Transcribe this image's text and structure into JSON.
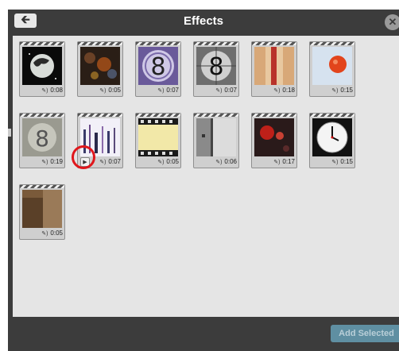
{
  "dialog": {
    "title": "Effects",
    "back_icon": "arrow-left-icon",
    "close_icon": "close-icon",
    "add_selected_label": "Add Selected"
  },
  "effects": [
    {
      "name": "earth-globe",
      "duration": "0:08"
    },
    {
      "name": "bokeh-lights",
      "duration": "0:05"
    },
    {
      "name": "countdown-8-purple",
      "duration": "0:07"
    },
    {
      "name": "countdown-8-gray",
      "duration": "0:07"
    },
    {
      "name": "film-burn-red",
      "duration": "0:18"
    },
    {
      "name": "orange-drop",
      "duration": "0:15"
    },
    {
      "name": "countdown-8-faded",
      "duration": "0:19"
    },
    {
      "name": "static-lines",
      "duration": "0:07"
    },
    {
      "name": "film-strip",
      "duration": "0:05"
    },
    {
      "name": "door-frame",
      "duration": "0:06"
    },
    {
      "name": "red-lights",
      "duration": "0:17"
    },
    {
      "name": "clock-face",
      "duration": "0:15"
    },
    {
      "name": "old-sepia",
      "duration": "0:05"
    }
  ],
  "colors": {
    "dialog_bg": "#3c3c3c",
    "grid_bg": "#e5e5e5",
    "highlight": "#e0171c",
    "add_button": "#5f8fa2"
  }
}
